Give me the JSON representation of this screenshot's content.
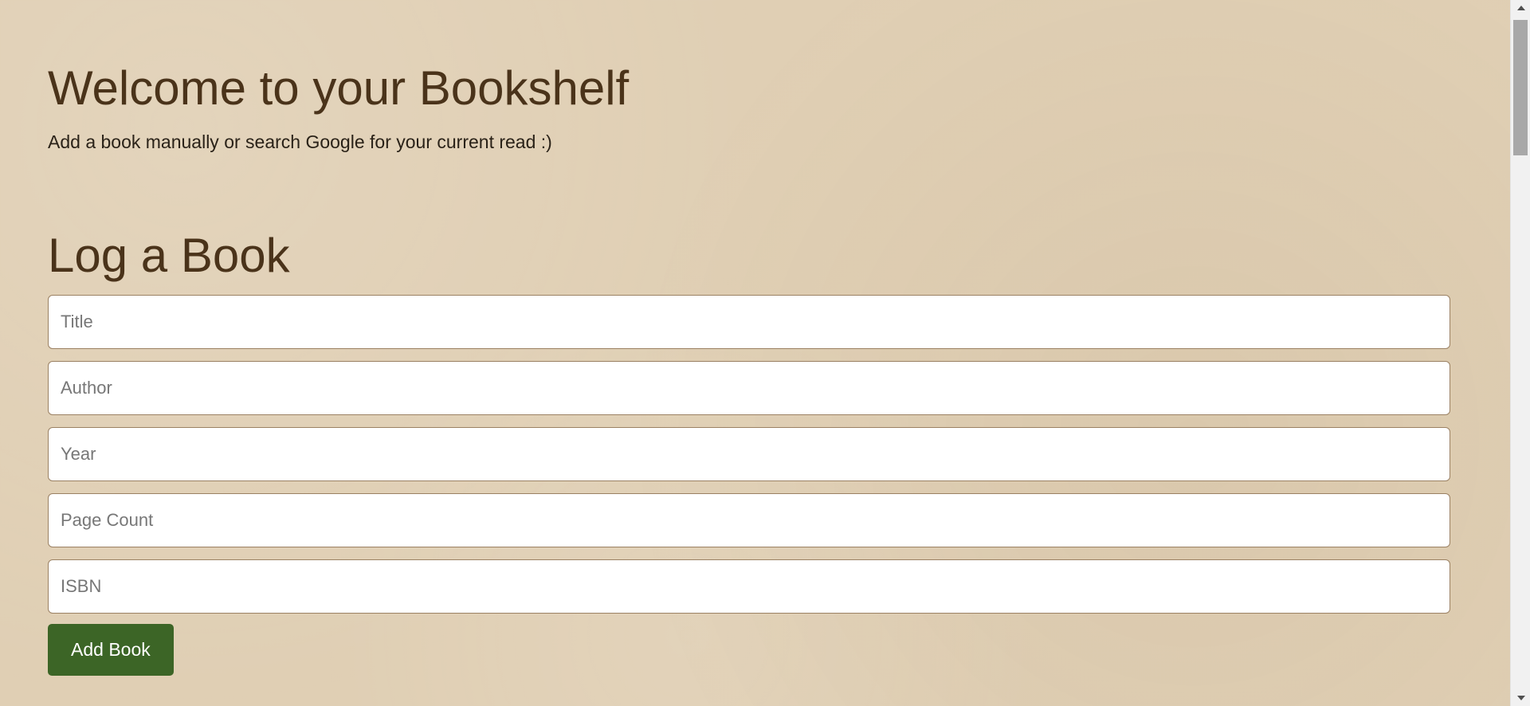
{
  "header": {
    "title": "Welcome to your Bookshelf",
    "subtitle": "Add a book manually or search Google for your current read :)"
  },
  "log_form": {
    "heading": "Log a Book",
    "fields": {
      "title": {
        "placeholder": "Title",
        "value": ""
      },
      "author": {
        "placeholder": "Author",
        "value": ""
      },
      "year": {
        "placeholder": "Year",
        "value": ""
      },
      "page_count": {
        "placeholder": "Page Count",
        "value": ""
      },
      "isbn": {
        "placeholder": "ISBN",
        "value": ""
      }
    },
    "submit_label": "Add Book"
  },
  "colors": {
    "background": "#e0cfb4",
    "heading": "#4a331a",
    "button": "#3c6526"
  },
  "scrollbar": {
    "scroll_position": 0
  }
}
